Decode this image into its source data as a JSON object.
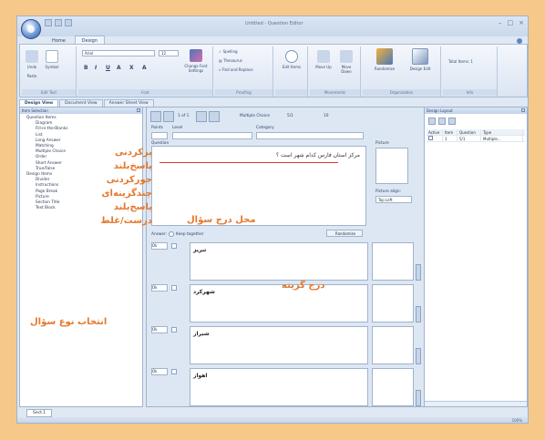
{
  "window": {
    "title": "Untitled - Question Editor"
  },
  "ribbon_tabs": [
    "Home",
    "Design"
  ],
  "ribbon": {
    "clipboard": {
      "paste": "Paste",
      "undo": "Undo",
      "symbol": "Symbol",
      "title": "Edit Text"
    },
    "font": {
      "font_name": "Arial",
      "font_size": "12",
      "title": "Font",
      "change_font_settings": "Change Font Settings"
    },
    "proofing": {
      "spelling": "Spelling",
      "thesaurus": "Thesaurus",
      "find_replace": "Find and Replace",
      "title": "Proofing"
    },
    "edit": {
      "edit_items": "Edit Items",
      "title": ""
    },
    "movements": {
      "move_up": "Move Up",
      "move_down": "Move Down",
      "title": "Movements"
    },
    "organization": {
      "randomize": "Randomize",
      "design_edit": "Design Edit",
      "title": "Organization"
    },
    "info": {
      "total_items": "Total Items: 1",
      "title": "Info"
    }
  },
  "view_tabs": [
    "Design View",
    "Document View",
    "Answer Sheet View"
  ],
  "left_panel": {
    "title": "Item Selection",
    "tree": [
      {
        "label": "Question Items",
        "level": 1
      },
      {
        "label": "Diagram",
        "level": 2
      },
      {
        "label": "Fill-in-the-Blanks",
        "level": 2
      },
      {
        "label": "List",
        "level": 2
      },
      {
        "label": "Long Answer",
        "level": 2
      },
      {
        "label": "Matching",
        "level": 2
      },
      {
        "label": "Multiple Choice",
        "level": 2
      },
      {
        "label": "Order",
        "level": 2
      },
      {
        "label": "Short Answer",
        "level": 2
      },
      {
        "label": "True/False",
        "level": 2
      },
      {
        "label": "Design Items",
        "level": 1
      },
      {
        "label": "Divider",
        "level": 2
      },
      {
        "label": "Instructions",
        "level": 2
      },
      {
        "label": "Page Break",
        "level": 2
      },
      {
        "label": "Picture",
        "level": 2
      },
      {
        "label": "Section Title",
        "level": 2
      },
      {
        "label": "Text Block",
        "level": 2
      }
    ]
  },
  "center": {
    "pager": "1 of 1",
    "question_type": "Multiple Choice",
    "ldq": "5/1",
    "points_value": "10",
    "points_label": "Points",
    "level_label": "Level",
    "category_label": "Category",
    "question_label": "Question",
    "question_text": "مرکز استان فارس کدام شهر است ؟",
    "picture_label": "Picture",
    "picture_align_label": "Picture align:",
    "picture_align_value": "Top Left",
    "answer_label": "Answer:",
    "keep_together_label": "Keep together",
    "randomize_button": "Randomize",
    "answers": [
      {
        "text": "تبریز",
        "select": "Ok"
      },
      {
        "text": "شهرکرد",
        "select": "Ok"
      },
      {
        "text": "شیراز",
        "select": "Ok"
      },
      {
        "text": "اهواز",
        "select": "Ok"
      }
    ]
  },
  "right_panel": {
    "title": "Design Layout",
    "columns": [
      "Active",
      "Item",
      "Question",
      "Type"
    ],
    "rows": [
      {
        "active": "",
        "item": "1",
        "question": "5/1",
        "type": "Multiple..."
      }
    ]
  },
  "sheet_tab": "Sect.1",
  "zoom": "100%",
  "annotations": {
    "types": [
      "پرکردنی",
      "پاسخ‌بلند",
      "جورکردنی",
      "چندگزینه‌ای",
      "پاسخ‌بلند",
      "درست/غلط"
    ],
    "select_type": "انتخاب نوع سؤال",
    "question_location": "محل درج سؤال",
    "insert_option": "درج گزینه"
  },
  "colors": {
    "frame_background": "#f6c98a",
    "annotation": "#e4782c",
    "window_blue": "#dfe8f3",
    "question_underline": "#dd3333"
  }
}
